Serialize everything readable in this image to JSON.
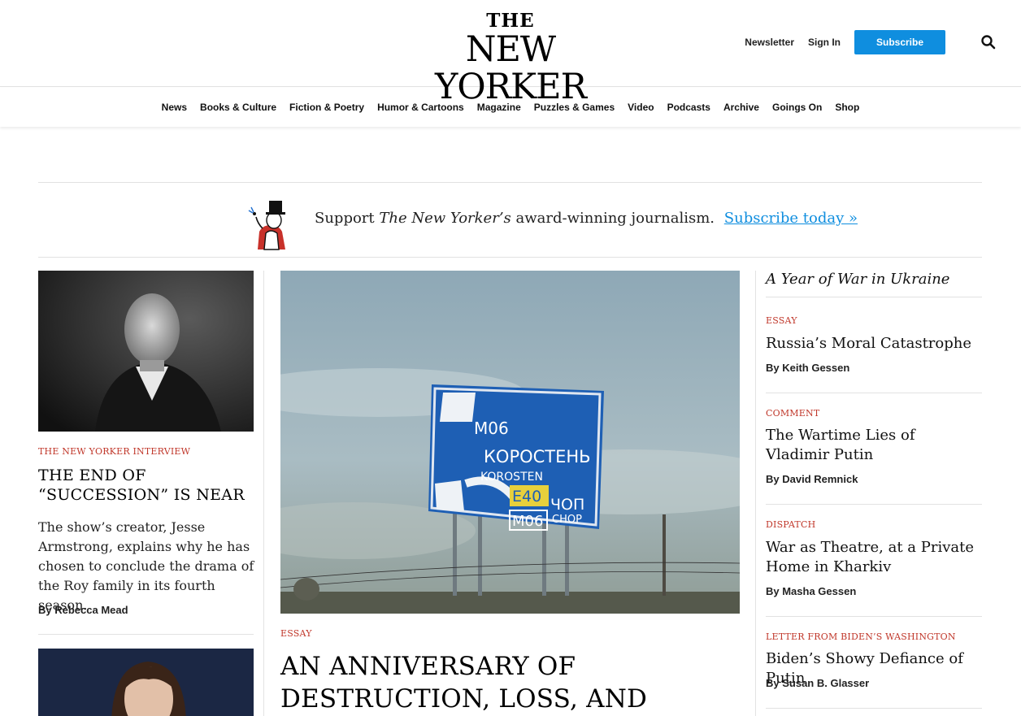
{
  "header": {
    "logo_the": "THE",
    "logo_name": "NEW YORKER",
    "newsletter": "Newsletter",
    "sign_in": "Sign In",
    "subscribe": "Subscribe"
  },
  "nav": {
    "items": [
      "News",
      "Books & Culture",
      "Fiction & Poetry",
      "Humor & Cartoons",
      "Magazine",
      "Puzzles & Games",
      "Video",
      "Podcasts",
      "Archive",
      "Goings On",
      "Shop"
    ]
  },
  "promo": {
    "support": "Support",
    "publication": "The New Yorker’s",
    "rest": "award-winning journalism.",
    "link": "Subscribe today »"
  },
  "left_story": {
    "rubric": "The New Yorker Interview",
    "headline": "The End of “Succession” Is Near",
    "dek": "The show’s creator, Jesse Armstrong, explains why he has chosen to conclude the drama of the Roy family in its fourth season.",
    "byline": "By Rebecca Mead"
  },
  "center_story": {
    "rubric": "Essay",
    "headline": "An Anniversary of Destruction, Loss, and Bravery in Ukraine",
    "sign_lines": [
      "М06",
      "КОРОСТЕНЬ",
      "KOROSTEN",
      "E40",
      "ЧОП",
      "CHOP",
      "М06"
    ]
  },
  "right_section": {
    "title": "A Year of War in Ukraine",
    "stories": [
      {
        "rubric": "Essay",
        "headline": "Russia’s Moral Catastrophe",
        "byline": "By Keith Gessen"
      },
      {
        "rubric": "Comment",
        "headline": "The Wartime Lies of Vladimir Putin",
        "byline": "By David Remnick"
      },
      {
        "rubric": "Dispatch",
        "headline": "War as Theatre, at a Private Home in Kharkiv",
        "byline": "By Masha Gessen"
      },
      {
        "rubric": "Letter from Biden’s Washington",
        "headline": "Biden’s Showy Defiance of Putin",
        "byline": "By Susan B. Glasser"
      }
    ]
  },
  "colors": {
    "accent_blue": "#0f8edf",
    "rubric_red": "#c0372a"
  }
}
